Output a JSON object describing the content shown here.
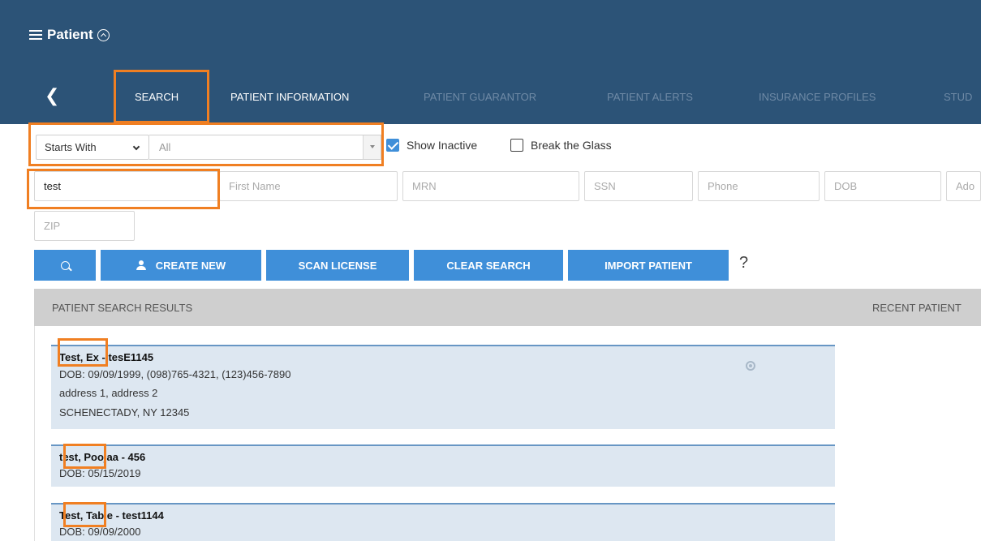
{
  "header": {
    "title": "Patient"
  },
  "tabs": [
    {
      "label": "SEARCH",
      "active": true
    },
    {
      "label": "PATIENT INFORMATION",
      "active": false
    },
    {
      "label": "PATIENT GUARANTOR",
      "active": false
    },
    {
      "label": "PATIENT ALERTS",
      "active": false
    },
    {
      "label": "INSURANCE PROFILES",
      "active": false
    },
    {
      "label": "STUD",
      "active": false
    }
  ],
  "filters": {
    "match_mode": "Starts With",
    "scope": "All",
    "show_inactive_label": "Show Inactive",
    "show_inactive_checked": true,
    "break_glass_label": "Break the Glass",
    "break_glass_checked": false
  },
  "fields": {
    "last_name_value": "test",
    "first_name_placeholder": "First Name",
    "mrn_placeholder": "MRN",
    "ssn_placeholder": "SSN",
    "phone_placeholder": "Phone",
    "dob_placeholder": "DOB",
    "address_placeholder": "Ado",
    "zip_placeholder": "ZIP"
  },
  "buttons": {
    "create_new": "CREATE NEW",
    "scan_license": "SCAN LICENSE",
    "clear_search": "CLEAR SEARCH",
    "import_patient": "IMPORT PATIENT",
    "help": "?"
  },
  "results": {
    "title": "PATIENT SEARCH RESULTS",
    "recent_title": "RECENT PATIENT",
    "items": [
      {
        "name": "Test, Ex - tesE1145",
        "dob_line": "DOB: 09/09/1999, (098)765-4321, (123)456-7890",
        "address_line": "address 1, address 2",
        "city_line": "SCHENECTADY, NY 12345"
      },
      {
        "name": "test, Poojaa - 456",
        "dob_line": "DOB: 05/15/2019"
      },
      {
        "name": "Test, Table - test1144",
        "dob_line": "DOB: 09/09/2000"
      }
    ]
  },
  "colors": {
    "header_bg": "#2c5377",
    "button_blue": "#3f8fd9",
    "highlight_orange": "#f07f22",
    "card_bg": "#dde7f1"
  }
}
